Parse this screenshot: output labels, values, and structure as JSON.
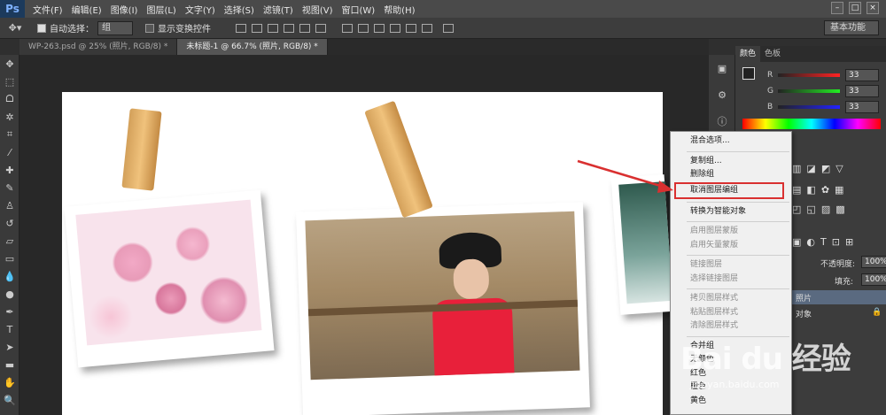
{
  "menubar": {
    "logo": "Ps",
    "items": [
      "文件(F)",
      "编辑(E)",
      "图像(I)",
      "图层(L)",
      "文字(Y)",
      "选择(S)",
      "滤镜(T)",
      "视图(V)",
      "窗口(W)",
      "帮助(H)"
    ]
  },
  "options": {
    "auto_select_label": "自动选择：",
    "auto_select_value": "组",
    "transform_label": "显示变换控件",
    "workspace": "基本功能"
  },
  "tabs": [
    {
      "label": "WP-263.psd @ 25% (照片, RGB/8) *"
    },
    {
      "label": "未标题-1 @ 66.7% (照片, RGB/8) *"
    }
  ],
  "color_panel": {
    "tabs": [
      "颜色",
      "色板"
    ],
    "r_label": "R",
    "g_label": "G",
    "b_label": "B",
    "r": "33",
    "g": "33",
    "b": "33"
  },
  "layers_panel": {
    "opacity_label": "不透明度:",
    "opacity": "100%",
    "fill_label": "填充:",
    "fill": "100%",
    "layer_label": "照片",
    "layer2_label": "对象"
  },
  "context_menu": {
    "items": [
      {
        "label": "混合选项...",
        "disabled": false
      },
      {
        "sep": true
      },
      {
        "label": "复制组...",
        "disabled": false
      },
      {
        "label": "删除组",
        "disabled": false
      },
      {
        "label": "取消图层编组",
        "disabled": false,
        "highlight": true
      },
      {
        "sep": true
      },
      {
        "label": "转换为智能对象",
        "disabled": false
      },
      {
        "sep": true
      },
      {
        "label": "启用图层蒙版",
        "disabled": true
      },
      {
        "label": "启用矢量蒙版",
        "disabled": true
      },
      {
        "sep": true
      },
      {
        "label": "链接图层",
        "disabled": true
      },
      {
        "label": "选择链接图层",
        "disabled": true
      },
      {
        "sep": true
      },
      {
        "label": "拷贝图层样式",
        "disabled": true
      },
      {
        "label": "粘贴图层样式",
        "disabled": true
      },
      {
        "label": "清除图层样式",
        "disabled": true
      },
      {
        "sep": true
      },
      {
        "label": "合并组",
        "disabled": false
      },
      {
        "label": "无颜色",
        "disabled": false
      },
      {
        "label": "红色",
        "disabled": false
      },
      {
        "label": "橙色",
        "disabled": false
      },
      {
        "label": "黄色",
        "disabled": false
      }
    ]
  },
  "watermark": {
    "text": "Bai du 经验",
    "url": "jingyan.baidu.com"
  },
  "colors": {
    "highlight_border": "#d93030",
    "arrow": "#d93030"
  }
}
